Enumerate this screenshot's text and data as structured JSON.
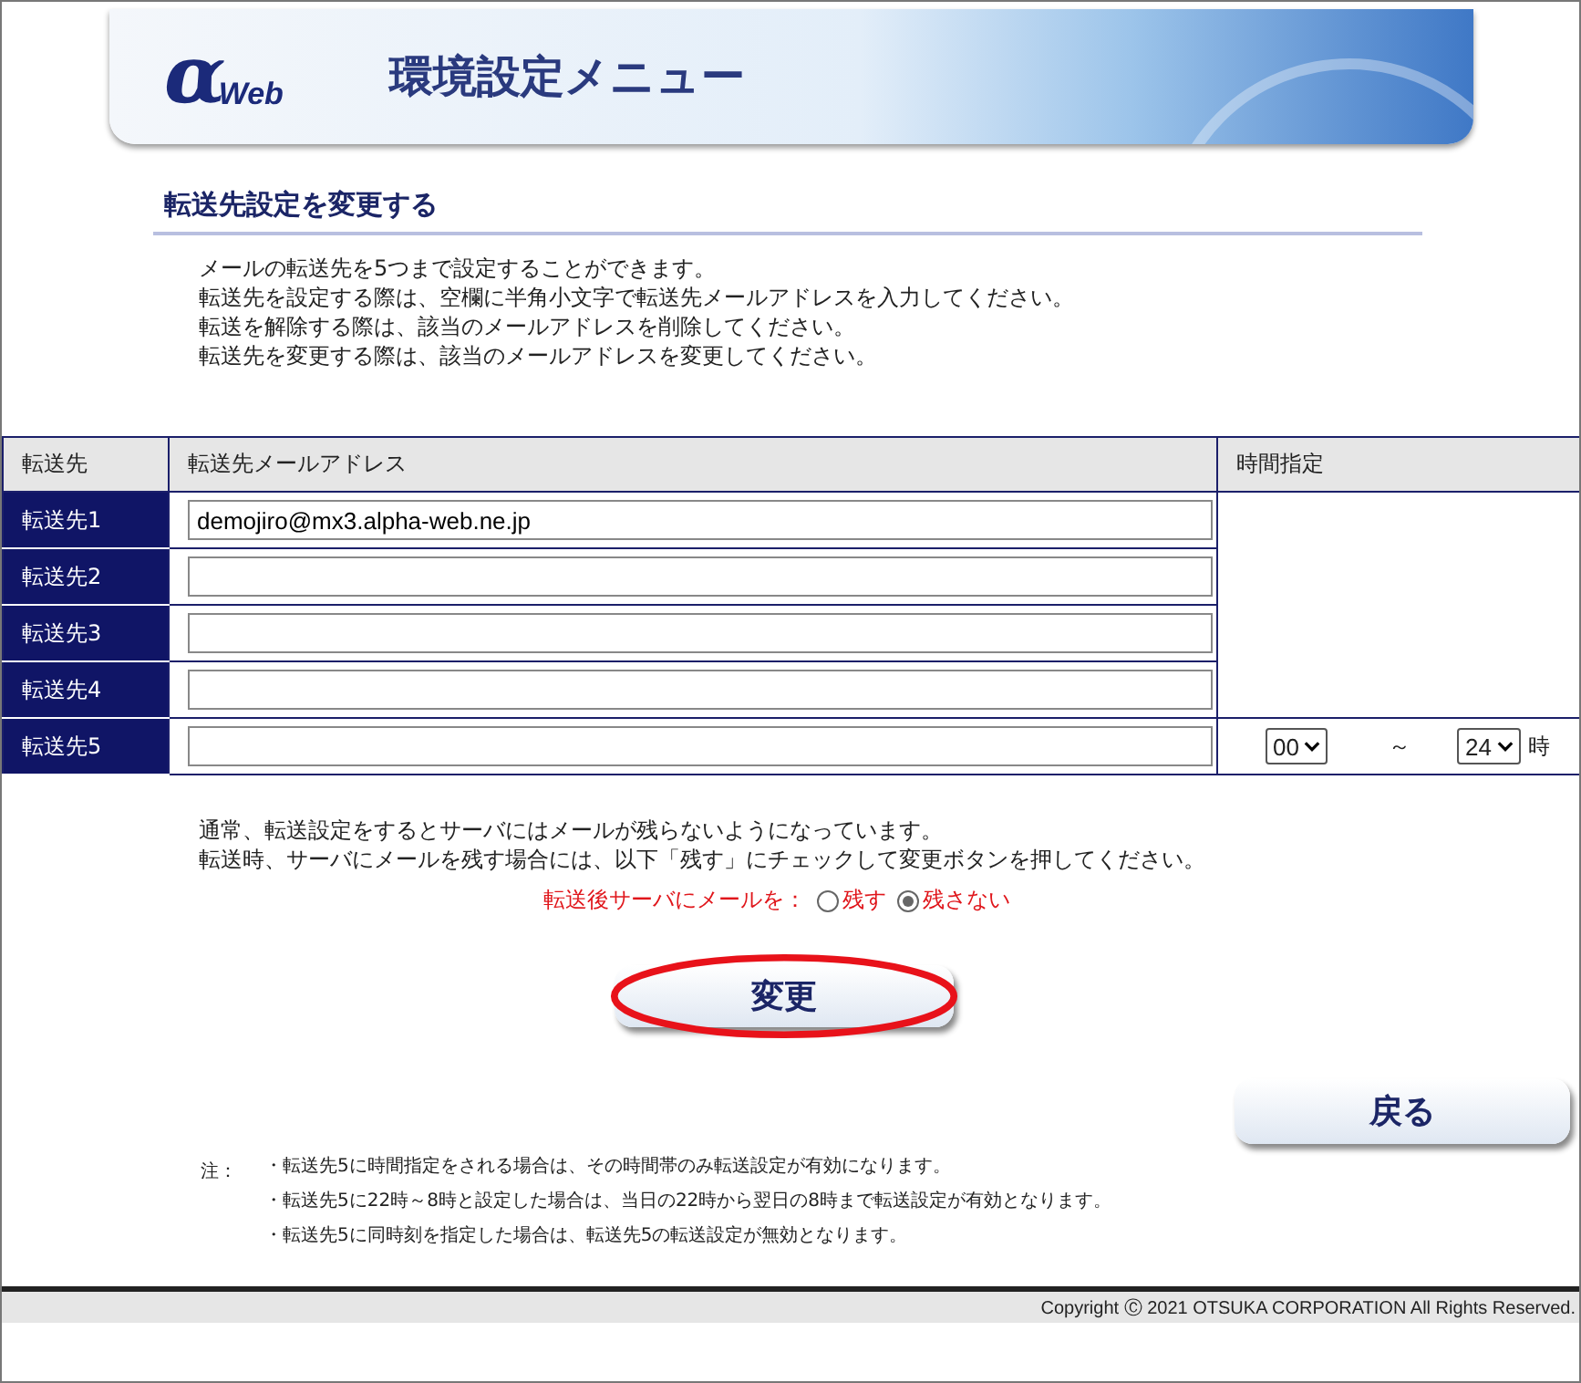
{
  "header": {
    "logo": {
      "mark": "α",
      "text": "Web"
    },
    "title": "環境設定メニュー"
  },
  "heading": "転送先設定を変更する",
  "intro": [
    "メールの転送先を5つまで設定することができます。",
    "転送先を設定する際は、空欄に半角小文字で転送先メールアドレスを入力してください。",
    "転送を解除する際は、該当のメールアドレスを削除してください。",
    "転送先を変更する際は、該当のメールアドレスを変更してください。"
  ],
  "table": {
    "columns": [
      "転送先",
      "転送先メールアドレス",
      "時間指定"
    ],
    "rows": [
      {
        "label": "転送先1",
        "value": "demojiro@mx3.alpha-web.ne.jp"
      },
      {
        "label": "転送先2"
      },
      {
        "label": "転送先3"
      },
      {
        "label": "転送先4"
      },
      {
        "label": "転送先5",
        "time": {
          "from": "00",
          "separator": "～",
          "to": "24",
          "unit": "時"
        }
      }
    ]
  },
  "notice": [
    "通常、転送設定をするとサーバにはメールが残らないようになっています。",
    "転送時、サーバにメールを残す場合には、以下「残す」にチェックして変更ボタンを押してください。"
  ],
  "keep_mail": {
    "label": "転送後サーバにメールを：",
    "options": [
      {
        "label": "残す",
        "selected": false
      },
      {
        "label": "残さない",
        "selected": true
      }
    ]
  },
  "change_button": {
    "label": "変更",
    "highlighted": true
  },
  "back_button": {
    "label": "戻る"
  },
  "notes": {
    "label": "注：",
    "items": [
      "・転送先5に時間指定をされる場合は、その時間帯のみ転送設定が有効になります。",
      "・転送先5に22時～8時と設定した場合は、当日の22時から翌日の8時まで転送設定が有効となります。",
      "・転送先5に同時刻を指定した場合は、転送先5の転送設定が無効となります。"
    ]
  },
  "footer": "Copyright Ⓒ 2021 OTSUKA CORPORATION All Rights Reserved."
}
